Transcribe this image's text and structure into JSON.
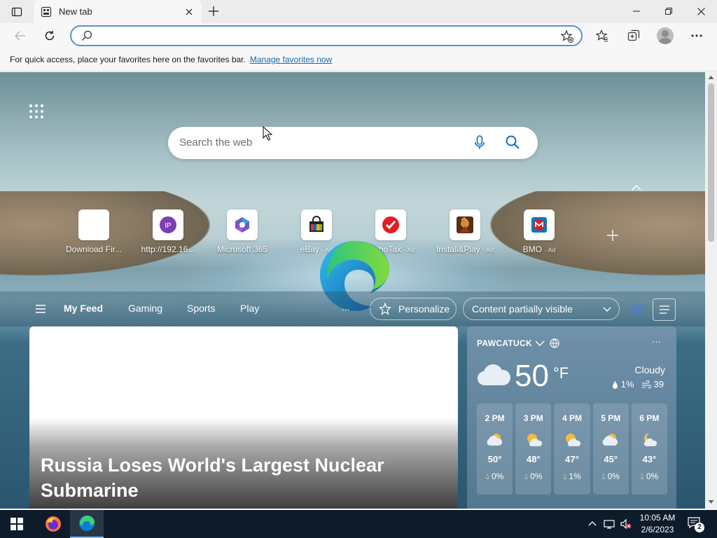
{
  "browser": {
    "tab": {
      "title": "New tab"
    },
    "address_bar": {
      "value": "",
      "placeholder": ""
    },
    "favorites_bar": {
      "message": "For quick access, place your favorites here on the favorites bar.",
      "link": "Manage favorites now"
    }
  },
  "newtab": {
    "search": {
      "placeholder": "Search the web"
    },
    "quick_links": [
      {
        "label": "Download Fir...",
        "ad": ""
      },
      {
        "label": "http://192.16...",
        "ad": ""
      },
      {
        "label": "Microsoft 365",
        "ad": ""
      },
      {
        "label": "eBay",
        "ad": "· Ad"
      },
      {
        "label": "TurboTax",
        "ad": "· Ad"
      },
      {
        "label": "Install&Play",
        "ad": "· Ad"
      },
      {
        "label": "BMO",
        "ad": "· Ad"
      }
    ],
    "feed_nav": {
      "tabs": [
        "My Feed",
        "Gaming",
        "Sports",
        "Play"
      ],
      "more": "...",
      "personalize": "Personalize",
      "content_visibility": "Content partially visible"
    },
    "article": {
      "headline": "Russia Loses World's Largest Nuclear Submarine"
    },
    "weather": {
      "location": "PAWCATUCK",
      "temperature": "50",
      "unit": "°F",
      "condition": "Cloudy",
      "precip": "1%",
      "wind": "39",
      "hourly": [
        {
          "time": "2 PM",
          "temp": "50°",
          "precip": "0%"
        },
        {
          "time": "3 PM",
          "temp": "48°",
          "precip": "0%"
        },
        {
          "time": "4 PM",
          "temp": "47°",
          "precip": "1%"
        },
        {
          "time": "5 PM",
          "temp": "45°",
          "precip": "0%"
        },
        {
          "time": "6 PM",
          "temp": "43°",
          "precip": "0%"
        }
      ]
    }
  },
  "taskbar": {
    "time": "10:05 AM",
    "date": "2/6/2023",
    "notification_count": "2"
  },
  "colors": {
    "accent": "#0f6cbd",
    "address_focus": "#5b8dd6",
    "taskbar": "#0e1b2b"
  }
}
